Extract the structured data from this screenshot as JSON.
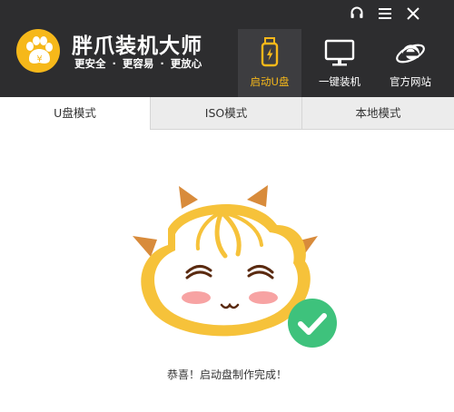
{
  "window_controls": {
    "support_icon": "headset-icon",
    "menu_icon": "hamburger-menu-icon",
    "close_icon": "close-icon"
  },
  "brand": {
    "title": "胖爪装机大师",
    "slogans": [
      "更安全",
      "更容易",
      "更放心"
    ],
    "separator": "·",
    "logo_icon": "paw-icon",
    "accent_color": "#f6b81a"
  },
  "nav": {
    "items": [
      {
        "label": "启动U盘",
        "icon": "usb-drive-icon",
        "active": true
      },
      {
        "label": "一键装机",
        "icon": "monitor-icon",
        "active": false
      },
      {
        "label": "官方网站",
        "icon": "ie-browser-icon",
        "active": false
      }
    ]
  },
  "tabs": {
    "items": [
      {
        "label": "U盘模式",
        "active": true
      },
      {
        "label": "ISO模式",
        "active": false
      },
      {
        "label": "本地模式",
        "active": false
      }
    ]
  },
  "content": {
    "mascot": "happy-mascot-illustration",
    "status_icon": "success-check-icon",
    "status_color": "#3ec27c",
    "message": "恭喜！启动盘制作完成！"
  }
}
